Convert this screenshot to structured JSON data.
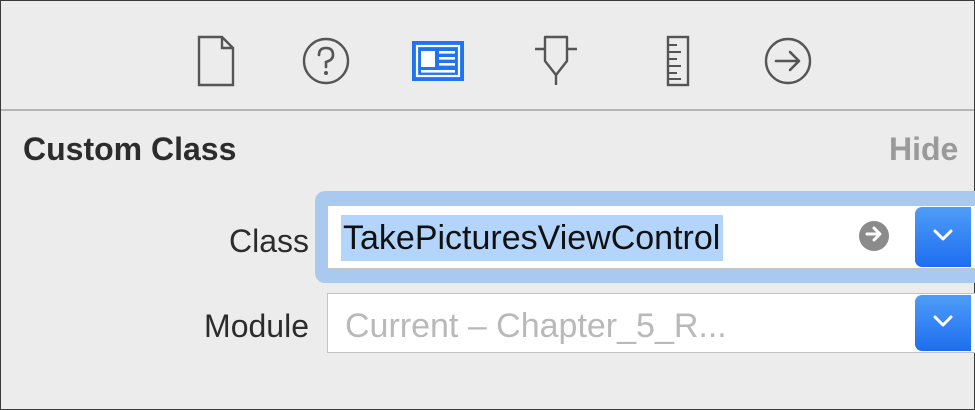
{
  "toolbar": {
    "icons": [
      {
        "name": "file-inspector-icon",
        "selected": false
      },
      {
        "name": "quick-help-icon",
        "selected": false
      },
      {
        "name": "identity-inspector-icon",
        "selected": true
      },
      {
        "name": "attributes-inspector-icon",
        "selected": false
      },
      {
        "name": "size-inspector-icon",
        "selected": false
      },
      {
        "name": "connections-inspector-icon",
        "selected": false
      }
    ],
    "selected_color": "#1f74f0",
    "icon_color": "#555555"
  },
  "section": {
    "title": "Custom Class",
    "hide_label": "Hide"
  },
  "class_field": {
    "label": "Class",
    "value": "TakePicturesViewControl"
  },
  "module_field": {
    "label": "Module",
    "placeholder": "Current – Chapter_5_R..."
  }
}
